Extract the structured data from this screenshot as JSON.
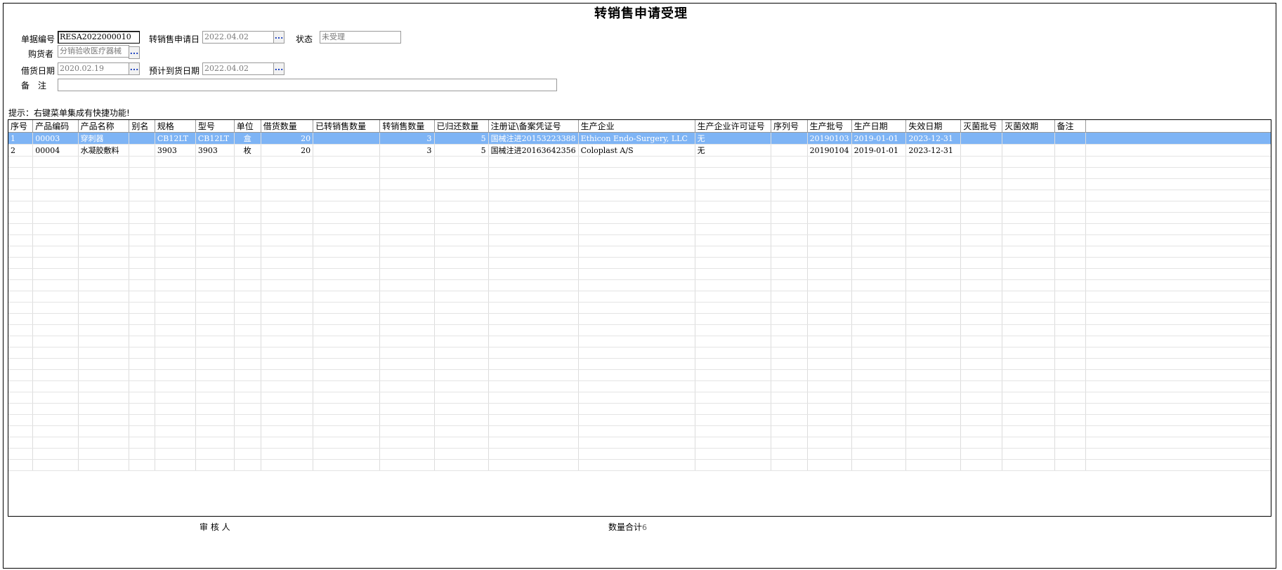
{
  "title": "转销售申请受理",
  "form": {
    "doc_no_label": "单据编号",
    "doc_no_value": "RESA2022000010",
    "apply_date_label": "转销售申请日",
    "apply_date_value": "2022.04.02",
    "status_label": "状态",
    "status_value": "未受理",
    "buyer_label": "购货者",
    "buyer_value": "分销验收医疗器械",
    "loan_date_label": "借货日期",
    "loan_date_value": "2020.02.19",
    "arrival_date_label": "预计到货日期",
    "arrival_date_value": "2022.04.02",
    "remark_label": "备　注",
    "remark_value": "",
    "ellipsis": "..."
  },
  "hint": "提示：右键菜单集成有快捷功能!",
  "table": {
    "columns": [
      "序号",
      "产品编码",
      "产品名称",
      "别名",
      "规格",
      "型号",
      "单位",
      "借货数量",
      "已转销售数量",
      "转销售数量",
      "已归还数量",
      "注册证\\备案凭证号",
      "生产企业",
      "生产企业许可证号",
      "序列号",
      "生产批号",
      "生产日期",
      "失效日期",
      "灭菌批号",
      "灭菌效期",
      "备注"
    ],
    "rows": [
      [
        "1",
        "00003",
        "穿刺器",
        "",
        "CB12LT",
        "CB12LT",
        "盒",
        "20",
        "",
        "3",
        "5",
        "国械注进20153223388",
        "Ethicon Endo-Surgery, LLC",
        "无",
        "",
        "20190103",
        "2019-01-01",
        "2023-12-31",
        "",
        "",
        ""
      ],
      [
        "2",
        "00004",
        "水凝胶敷料",
        "",
        "3903",
        "3903",
        "枚",
        "20",
        "",
        "3",
        "5",
        "国械注进20163642356",
        "Coloplast A/S",
        "无",
        "",
        "20190104",
        "2019-01-01",
        "2023-12-31",
        "",
        "",
        ""
      ]
    ],
    "selected_row": 0
  },
  "footer": {
    "reviewer_label": "审 核 人",
    "qty_total_label": "数量合计",
    "qty_total_value": "6"
  }
}
